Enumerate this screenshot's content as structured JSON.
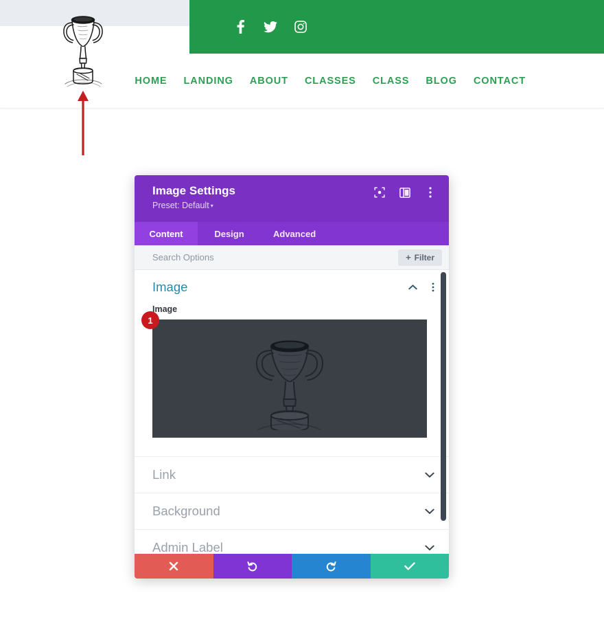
{
  "site": {
    "social_icons": [
      {
        "name": "facebook-icon",
        "label": "Facebook"
      },
      {
        "name": "twitter-icon",
        "label": "Twitter"
      },
      {
        "name": "instagram-icon",
        "label": "Instagram"
      }
    ],
    "logo_alt": "Trophy logo",
    "nav": [
      {
        "label": "HOME"
      },
      {
        "label": "LANDING"
      },
      {
        "label": "ABOUT"
      },
      {
        "label": "CLASSES"
      },
      {
        "label": "CLASS"
      },
      {
        "label": "BLOG"
      },
      {
        "label": "CONTACT"
      }
    ],
    "colors": {
      "green_bar": "#22984b",
      "nav_link": "#2f9e55",
      "top_strip": "#e9edf2"
    }
  },
  "annotation": {
    "arrow_color": "#c0201f",
    "arrow_direction": "up",
    "points_at": "logo"
  },
  "modal": {
    "title": "Image Settings",
    "preset_label": "Preset: Default",
    "preset_caret": "▾",
    "titlebar_icons": [
      {
        "name": "focus-target-icon"
      },
      {
        "name": "panel-layout-icon"
      },
      {
        "name": "more-vertical-icon"
      }
    ],
    "tabs": [
      {
        "label": "Content",
        "active": true
      },
      {
        "label": "Design",
        "active": false
      },
      {
        "label": "Advanced",
        "active": false
      }
    ],
    "search": {
      "placeholder": "Search Options",
      "value": ""
    },
    "filter_button": {
      "plus": "+",
      "label": "Filter"
    },
    "sections": [
      {
        "title": "Image",
        "expanded": true,
        "collapse_icon": "chevron-up-icon",
        "menu_icon": "more-vertical-icon"
      }
    ],
    "image_field": {
      "label": "Image",
      "badge": "1",
      "preview_bg": "#3b4047",
      "preview_alt": "Trophy sketch"
    },
    "collapsed_sections": [
      {
        "label": "Link"
      },
      {
        "label": "Background"
      },
      {
        "label": "Admin Label"
      }
    ],
    "footer_buttons": [
      {
        "name": "cancel-button",
        "icon": "close-icon",
        "color": "#e35b55"
      },
      {
        "name": "undo-button",
        "icon": "undo-icon",
        "color": "#8134d4"
      },
      {
        "name": "redo-button",
        "icon": "redo-icon",
        "color": "#2585d1"
      },
      {
        "name": "save-button",
        "icon": "check-icon",
        "color": "#2fbf9c"
      }
    ],
    "colors": {
      "titlebar": "#7b30c4",
      "tabbar": "#8335d1",
      "tab_active": "#9340e0",
      "section_title": "#2b87a8",
      "badge": "#c9181e"
    }
  }
}
